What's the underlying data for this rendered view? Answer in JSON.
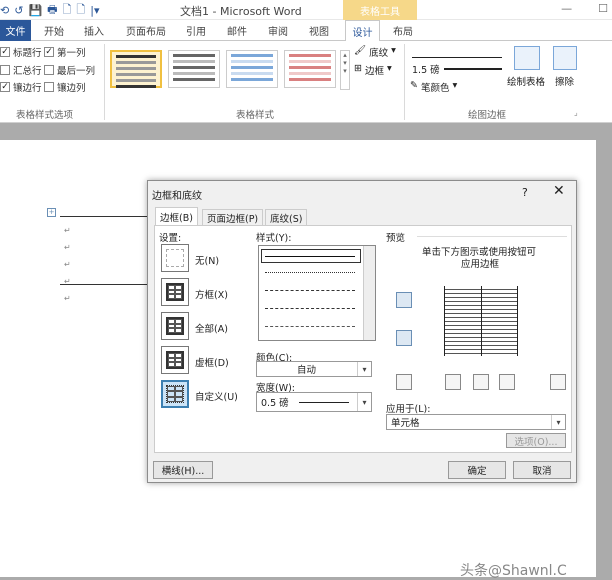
{
  "titlebar": {
    "title": "文档1 - Microsoft Word",
    "context_tab": "表格工具",
    "qat": [
      "⟲",
      "↺",
      "💾",
      "🖶",
      "🗋",
      "🗋",
      "|▾"
    ],
    "win_buttons": [
      "—",
      "☐"
    ]
  },
  "tabs": {
    "file": "文件",
    "items": [
      "开始",
      "插入",
      "页面布局",
      "引用",
      "邮件",
      "审阅",
      "视图"
    ],
    "design": "设计",
    "layout": "布局"
  },
  "ribbon": {
    "options": {
      "header_row": "标题行",
      "first_col": "第一列",
      "total_row": "汇总行",
      "last_col": "最后一列",
      "banded_rows": "镶边行",
      "banded_cols": "镶边列",
      "group_label": "表格样式选项"
    },
    "styles_group_label": "表格样式",
    "shading": "底纹",
    "borders": "边框",
    "pen_weight": "1.5 磅",
    "pen_color": "笔颜色",
    "draw_table": "绘制表格",
    "eraser": "擦除",
    "borders_group_label": "绘图边框"
  },
  "dialog": {
    "title": "边框和底纹",
    "help": "?",
    "close": "✕",
    "tabs": [
      "边框(B)",
      "页面边框(P)",
      "底纹(S)"
    ],
    "settings_label": "设置:",
    "settings": [
      "无(N)",
      "方框(X)",
      "全部(A)",
      "虚框(D)",
      "自定义(U)"
    ],
    "style_label": "样式(Y):",
    "color_label": "颜色(C):",
    "color_value": "自动",
    "width_label": "宽度(W):",
    "width_value": "0.5 磅",
    "preview_label": "预览",
    "preview_hint_1": "单击下方图示或使用按钮可",
    "preview_hint_2": "应用边框",
    "apply_to_label": "应用于(L):",
    "apply_to_value": "单元格",
    "options_button": "选项(O)...",
    "horizontal_line_button": "横线(H)...",
    "ok_button": "确定",
    "cancel_button": "取消"
  },
  "watermark": "头条@Shawnl.C"
}
